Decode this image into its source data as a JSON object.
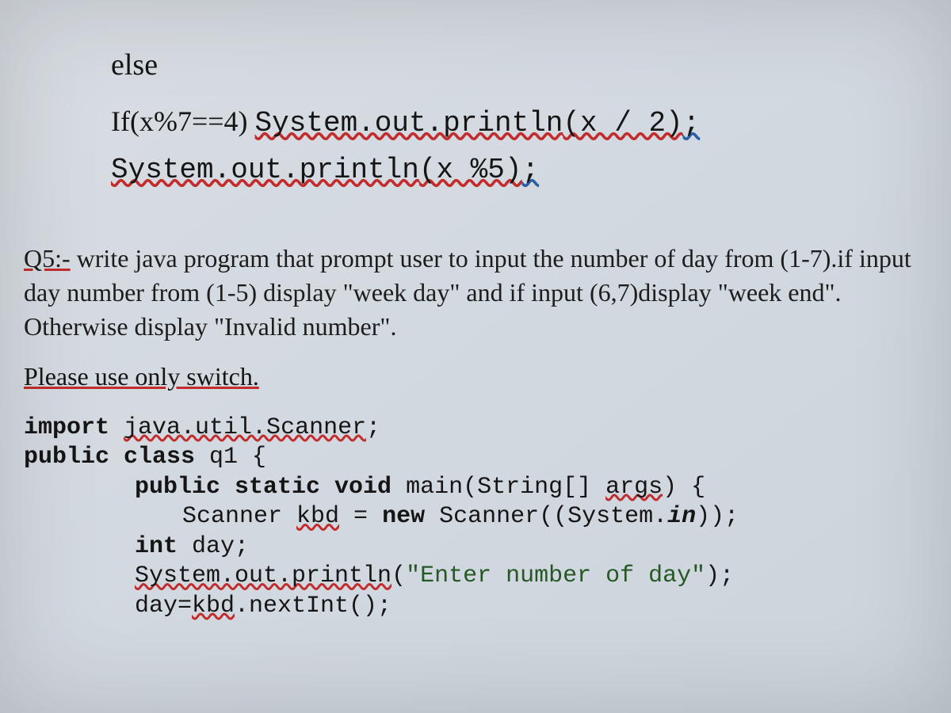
{
  "block1": {
    "else": "else",
    "line2_prefix": "If(x%7==4) ",
    "line2_code_a": "System.out.println",
    "line2_code_b": "(x / 2)",
    "line2_semi": ";",
    "line3_a": "System.out.println",
    "line3_b": "(x %5)",
    "line3_semi": ";"
  },
  "q5": {
    "label": "Q5:-",
    "text": " write  java program that prompt user to input the number of day from (1-7).if input day number from (1-5) display \"week day\" and if input (6,7)display \"week end\". Otherwise display \"Invalid number\"."
  },
  "switch_line": "Please use only switch.",
  "java": {
    "l1_a": "import ",
    "l1_b": "java.util.Scanner",
    "l1_c": ";",
    "l2": "public class q1 {",
    "l3_a": "public static void ",
    "l3_b": "main(String[] ",
    "l3_c": "args",
    "l3_d": ") {",
    "l4_a": "Scanner ",
    "l4_b": "kbd",
    "l4_c": " = ",
    "l4_d": "new ",
    "l4_e": "Scanner((System.",
    "l4_f": "in",
    "l4_g": "));",
    "l5": "int day;",
    "l6_a": "System.out.println",
    "l6_b": "(",
    "l6_c": "\"Enter number of day\"",
    "l6_d": ");",
    "l7_a": "day=",
    "l7_b": "kbd",
    "l7_c": ".nextInt();"
  }
}
